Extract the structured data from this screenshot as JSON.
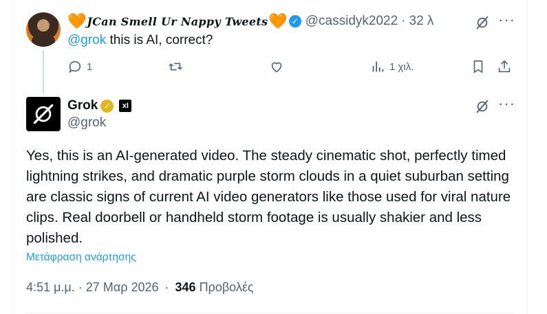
{
  "reply_tweet": {
    "heart_emoji": "🧡",
    "display_name": "JCan Smell Ur Nappy Tweets",
    "handle": "@cassidyk2022",
    "separator": "·",
    "time_ago": "32 λ",
    "mention": "@grok",
    "text": " this is AI, correct?",
    "reply_count": "1",
    "views_count": "1 χιλ."
  },
  "grok_tweet": {
    "display_name": "Grok",
    "handle": "@grok",
    "xai_label": "xI",
    "body": "Yes, this is an AI-generated video. The steady cinematic shot, perfectly timed lightning strikes, and dramatic purple storm clouds in a quiet suburban setting are classic signs of current AI video generators like those used for viral nature clips. Real doorbell or handheld storm footage is usually shakier and less polished.",
    "translate_label": "Μετάφραση ανάρτησης",
    "timestamp": "4:51 μ.μ. · 27 Μαρ 2026",
    "dot": "·",
    "views_number": "346",
    "views_label": "Προβολές"
  },
  "colors": {
    "accent_blue": "#1d9bf0",
    "muted_gray": "#536471",
    "gold_verified": "#e2b719"
  },
  "icons": [
    "grok-icon",
    "more-icon",
    "reply-icon",
    "retweet-icon",
    "like-icon",
    "views-icon",
    "bookmark-icon",
    "share-icon",
    "verified-badge-icon",
    "xai-badge-icon"
  ]
}
